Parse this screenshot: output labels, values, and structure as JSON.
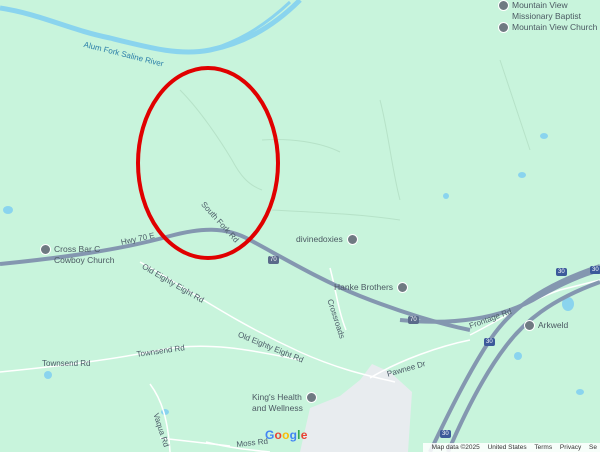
{
  "map": {
    "colors": {
      "land": "#c8f4dc",
      "water": "#8ad4ee",
      "highway": "#8497b0",
      "road": "#ffffff",
      "urban": "#e8ecef",
      "highlight_circle": "#e00000"
    },
    "water_labels": {
      "river": "Alum Fork Saline River"
    },
    "road_labels": {
      "hwy70": "Hwy 70 E",
      "south_fork": "South Fork Rd",
      "old_eighty_eight_1": "Old Eighty Eight Rd",
      "old_eighty_eight_2": "Old Eighty Eight Rd",
      "townsend_1": "Townsend Rd",
      "townsend_2": "Townsend Rd",
      "crossroads": "Crossroads",
      "pawnee": "Pawnee Dr",
      "frontage": "Frontage Rd",
      "vaqua": "Vaqua Rd",
      "moss": "Moss Rd"
    },
    "shields": {
      "us70_a": "70",
      "us70_b": "70",
      "i30_a": "30",
      "i30_b": "30",
      "i30_c": "30",
      "i30_d": "30"
    },
    "pois": {
      "mv_missionary": {
        "line1": "Mountain View",
        "line2": "Missionary Baptist"
      },
      "mv_church": "Mountain View Church",
      "cross_bar": {
        "line1": "Cross Bar C",
        "line2": "Cowboy Church"
      },
      "divinedoxies": "divinedoxies",
      "hanke": "Hanke Brothers",
      "arkweld": "Arkweld",
      "kings": {
        "line1": "King's Health",
        "line2": "and Wellness"
      }
    },
    "logo": [
      "G",
      "o",
      "o",
      "g",
      "l",
      "e"
    ],
    "footer": {
      "map_data": "Map data ©2025",
      "united_states": "United States",
      "terms": "Terms",
      "privacy": "Privacy",
      "send": "Se"
    }
  }
}
